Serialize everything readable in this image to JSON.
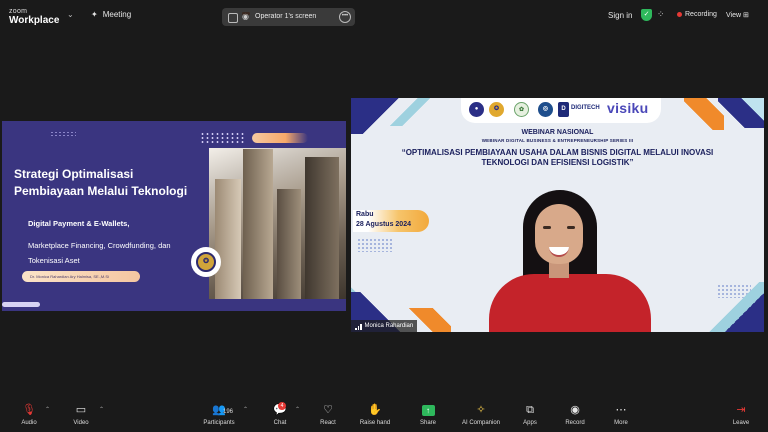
{
  "topbar": {
    "brand_line1": "zoom",
    "brand_line2": "Workplace",
    "meeting_label": "Meeting",
    "share_label": "Operator 1's screen",
    "signin_label": "Sign in",
    "recording_label": "Recording",
    "view_label": "View"
  },
  "slide": {
    "title": "Strategi Optimalisasi Pembiayaan Melalui Teknologi",
    "subtitle1": "Digital Payment & E-Wallets,",
    "subtitle2": "Marketplace Financing, Crowdfunding, dan Tokenisasi Aset",
    "author": "Dr. Monica Rahardian Ary Halmisa, SE.,M.Si"
  },
  "video": {
    "logo_text": "DIGITECH",
    "brand": "visiku",
    "webinar_title": "WEBINAR NASIONAL",
    "series": "WEBINAR DIGITAL BUSINESS & ENTREPRENEURSHIP SERIES III",
    "headline": "“OPTIMALISASI PEMBIAYAAN USAHA DALAM BISNIS DIGITAL MELALUI INOVASI TEKNOLOGI DAN EFISIENSI LOGISTIK”",
    "day": "Rabu",
    "date": "28 Agustus 2024",
    "participant_name": "Monica Rahardian"
  },
  "toolbar": {
    "audio": "Audio",
    "video": "Video",
    "participants": "Participants",
    "participants_count": "196",
    "chat": "Chat",
    "chat_badge": "4",
    "react": "React",
    "raise_hand": "Raise hand",
    "share": "Share",
    "ai_companion": "AI Companion",
    "apps": "Apps",
    "record": "Record",
    "more": "More",
    "leave": "Leave"
  },
  "colors": {
    "background": "#1a1a1a",
    "slide_bg": "#3a3580",
    "accent_orange": "#f08a2b",
    "accent_navy": "#2b2f86",
    "recording_red": "#e53935",
    "share_green": "#2eb85c"
  }
}
